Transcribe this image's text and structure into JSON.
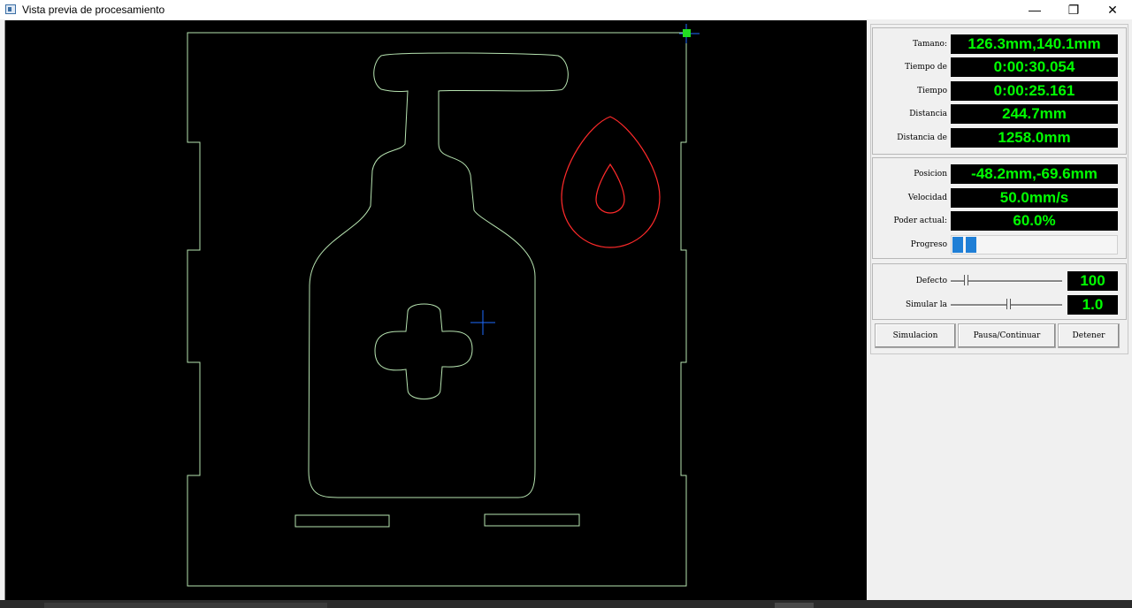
{
  "window": {
    "title": "Vista previa de procesamiento",
    "minimize_glyph": "—",
    "restore_glyph": "❐",
    "close_glyph": "✕"
  },
  "info": [
    {
      "label": "Tamano:",
      "value": "126.3mm,140.1mm"
    },
    {
      "label": "Tiempo de",
      "value": "0:00:30.054"
    },
    {
      "label": "Tiempo",
      "value": "0:00:25.161"
    },
    {
      "label": "Distancia",
      "value": "244.7mm"
    },
    {
      "label": "Distancia de",
      "value": "1258.0mm"
    }
  ],
  "status": [
    {
      "label": "Posicion",
      "value": "-48.2mm,-69.6mm"
    },
    {
      "label": "Velocidad",
      "value": "50.0mm/s"
    },
    {
      "label": "Poder actual:",
      "value": "60.0%"
    }
  ],
  "progress": {
    "label": "Progreso",
    "fraction": 0.16
  },
  "sliders": [
    {
      "label": "Defecto",
      "value": "100",
      "position": 0.12
    },
    {
      "label": "Simular la",
      "value": "1.0",
      "position": 0.5
    }
  ],
  "buttons": {
    "simulate": "Simulacion",
    "pause": "Pausa/Continuar",
    "stop": "Detener"
  },
  "colors": {
    "canvas_bg": "#000000",
    "path_green": "#b6e3b0",
    "path_red": "#ff2a2a",
    "cursor_blue": "#1e6bff",
    "readout_text": "#00ff00"
  }
}
